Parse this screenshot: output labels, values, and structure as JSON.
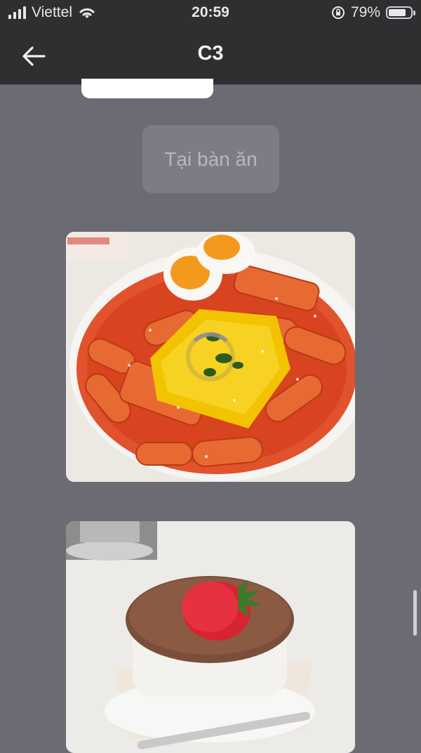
{
  "status_bar": {
    "carrier": "Viettel",
    "time": "20:59",
    "battery": "79%",
    "battery_level": 0.79
  },
  "header": {
    "title": "C3"
  },
  "chat": {
    "chip_label": "Tại bàn ăn"
  },
  "icons": {
    "signal": "signal-icon",
    "wifi": "wifi-icon",
    "orientation_lock": "rotation-lock-icon",
    "battery": "battery-icon",
    "back": "back-arrow-icon",
    "loading": "loading-spinner-icon"
  }
}
